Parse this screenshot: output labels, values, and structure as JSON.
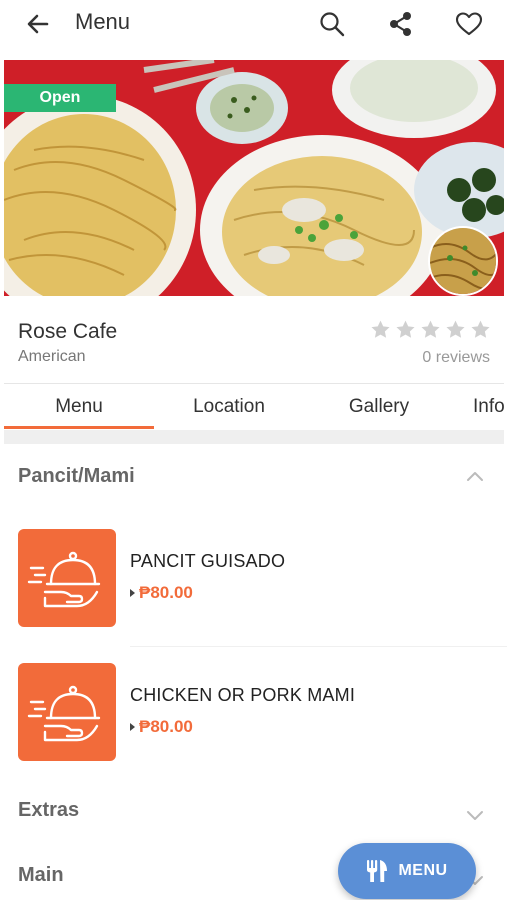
{
  "appbar": {
    "title": "Menu",
    "icons": [
      "back-arrow-icon",
      "search-icon",
      "share-icon",
      "heart-icon"
    ]
  },
  "hero": {
    "status_badge": "Open",
    "colors": {
      "open_badge": "#2bb673"
    }
  },
  "restaurant": {
    "name": "Rose Cafe",
    "cuisine": "American",
    "rating_stars": 0,
    "reviews_text": "0 reviews"
  },
  "tabs": [
    {
      "label": "Menu",
      "active": true
    },
    {
      "label": "Location",
      "active": false
    },
    {
      "label": "Gallery",
      "active": false
    },
    {
      "label": "Info",
      "active": false
    }
  ],
  "sections": [
    {
      "title": "Pancit/Mami",
      "expanded": true,
      "items": [
        {
          "name": "PANCIT GUISADO",
          "price": "₱80.00"
        },
        {
          "name": "CHICKEN OR PORK MAMI",
          "price": "₱80.00"
        }
      ]
    },
    {
      "title": "Extras",
      "expanded": false
    },
    {
      "title": "Main",
      "expanded": false
    }
  ],
  "fab": {
    "label": "MENU",
    "icon": "fork-knife-icon"
  },
  "colors": {
    "accent": "#f26b3a",
    "fab": "#5b8fd6",
    "star": "#d0d0d0"
  }
}
